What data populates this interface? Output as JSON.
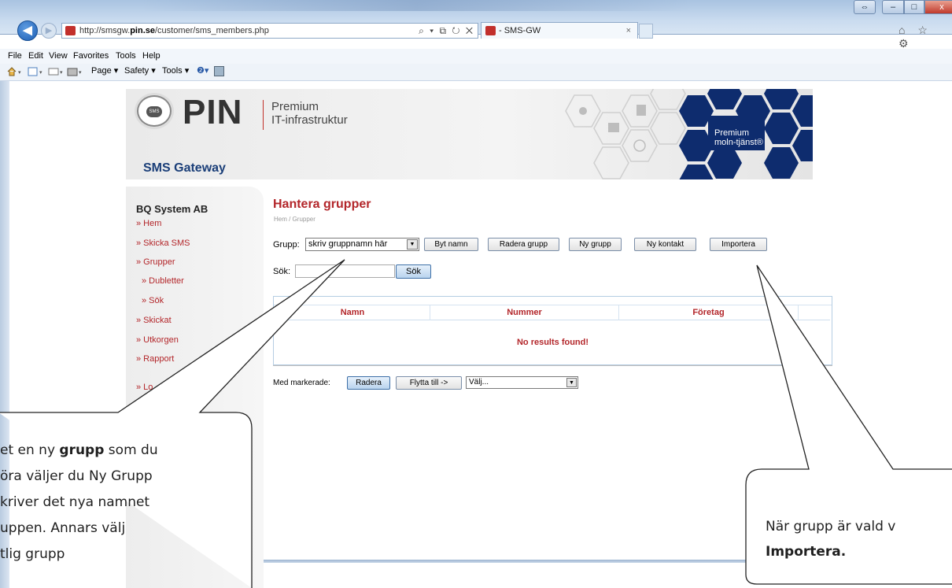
{
  "browser": {
    "url_prefix": "http://smsgw.",
    "url_domain": "pin.se",
    "url_path": "/customer/sms_members.php",
    "addr_controls": "⌕ ▾ ⧉ ↻ ✕",
    "tab_title": "- SMS-GW",
    "tab_close": "×",
    "back": "◀",
    "forward": "▶",
    "win_restore": "⇔",
    "win_min": "–",
    "win_max": "□",
    "win_close": "x",
    "right_icons": "⌂ ☆ ⚙"
  },
  "menu": [
    "File",
    "Edit",
    "View",
    "Favorites",
    "Tools",
    "Help"
  ],
  "commandbar": {
    "page": "Page ▾",
    "safety": "Safety ▾",
    "tools": "Tools ▾",
    "help": "❷▾"
  },
  "header": {
    "logo_text": "PIN",
    "logo_bubble": "SMS",
    "tagline1": "Premium",
    "tagline2": "IT-infrastruktur",
    "product": "SMS Gateway",
    "promo_line1": "Premium",
    "promo_line2": "moln-tjänst®"
  },
  "sidebar": {
    "company": "BQ System AB",
    "items": [
      "» Hem",
      "» Skicka SMS",
      "» Grupper",
      "» Dubletter",
      "» Sök",
      "» Skickat",
      "» Utkorgen",
      "» Rapport",
      "» Lo"
    ]
  },
  "main": {
    "title": "Hantera grupper",
    "breadcrumb": "Hem / Grupper",
    "group_label": "Grupp:",
    "group_value": "skriv gruppnamn här",
    "buttons": {
      "rename": "Byt namn",
      "delete_group": "Radera grupp",
      "new_group": "Ny grupp",
      "new_contact": "Ny kontakt",
      "import": "Importera"
    },
    "search_label": "Sök:",
    "search_value": "",
    "search_button": "Sök",
    "table": {
      "columns": [
        "Namn",
        "Nummer",
        "Företag"
      ],
      "empty_message": "No results found!"
    },
    "selected_label": "Med markerade:",
    "delete_button": "Radera",
    "move_button": "Flytta till ->",
    "move_select": "Välj..."
  },
  "callouts": {
    "left": [
      "et en ny ",
      "grupp",
      " som du",
      "öra väljer du Ny Grupp",
      "kriver det nya namnet",
      "uppen. Annars välj",
      "tlig grupp"
    ],
    "right": [
      "När grupp är vald v",
      "Importera."
    ]
  }
}
